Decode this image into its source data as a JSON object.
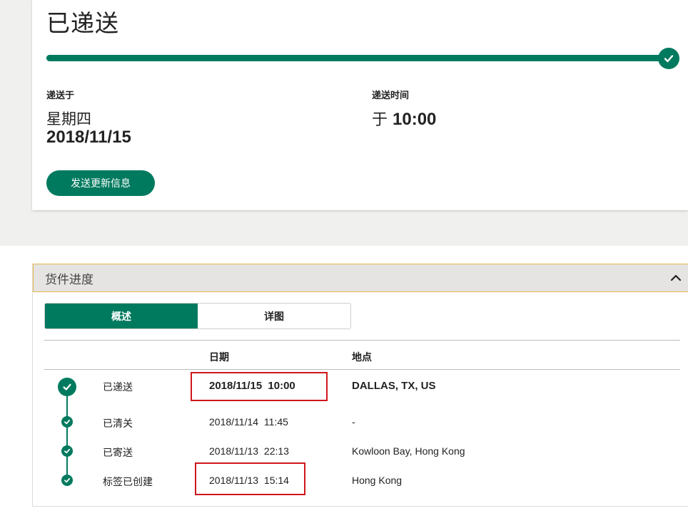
{
  "status": {
    "title": "已递送",
    "progress_percent": 100,
    "delivered_on_label": "递送于",
    "delivered_weekday": "星期四",
    "delivered_date": "2018/11/15",
    "delivery_time_label": "递送时间",
    "delivery_time_prefix": "于",
    "delivery_time_value": "10:00",
    "update_button_label": "发送更新信息"
  },
  "panel": {
    "title": "货件进度",
    "tabs": [
      {
        "label": "概述",
        "active": true
      },
      {
        "label": "详图",
        "active": false
      }
    ],
    "columns": {
      "date": "日期",
      "location": "地点"
    },
    "rows": [
      {
        "status": "已递送",
        "datetime": "2018/11/15 10:00",
        "location": "DALLAS, TX, US"
      },
      {
        "status": "已清关",
        "datetime": "2018/11/14 11:45",
        "location": "-"
      },
      {
        "status": "已寄送",
        "datetime": "2018/11/13 22:13",
        "location": "Kowloon Bay, Hong Kong"
      },
      {
        "status": "标签已创建",
        "datetime": "2018/11/13 15:14",
        "location": "Hong Kong"
      }
    ]
  },
  "colors": {
    "accent": "#007a5e",
    "highlight": "#d0161b",
    "header_border": "#e8b54a"
  },
  "icons": {
    "progress_end": "check-circle-icon",
    "collapse": "chevron-up-icon",
    "timeline_node": "check-circle-icon"
  }
}
